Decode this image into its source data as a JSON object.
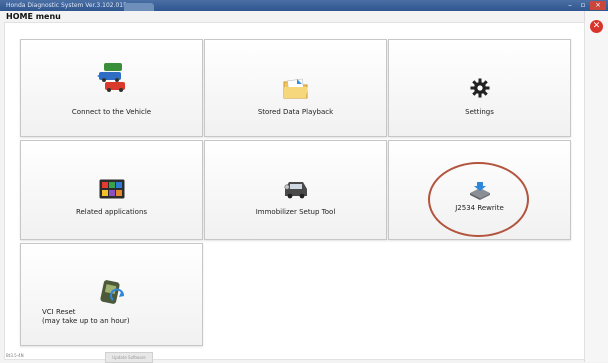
{
  "window": {
    "title": "Honda Diagnostic System Ver.3.102.015",
    "minimize_glyph": "–",
    "maximize_glyph": "▫",
    "close_glyph": "×"
  },
  "menu_label": "HOME menu",
  "exit_icon_glyph": "✕",
  "tiles": [
    {
      "label": "Connect to the Vehicle",
      "icon": "vehicle-connect-icon"
    },
    {
      "label": "Stored Data Playback",
      "icon": "folder-icon"
    },
    {
      "label": "Settings",
      "icon": "gear-icon"
    },
    {
      "label": "Related applications",
      "icon": "apps-grid-icon"
    },
    {
      "label": "Immobilizer Setup Tool",
      "icon": "car-key-icon"
    },
    {
      "label": "J2534 Rewrite",
      "icon": "rewrite-download-icon"
    },
    {
      "label_line1": "VCI Reset",
      "label_line2": "(may take up to an hour)",
      "icon": "vci-reset-icon"
    }
  ],
  "status_bar": {
    "left_text": "Bt3.5-4N",
    "button_label": "Update Software"
  },
  "colors": {
    "titlebar": "#3c6298",
    "highlight_ring": "#b2543e",
    "exit_button": "#d9342b"
  }
}
